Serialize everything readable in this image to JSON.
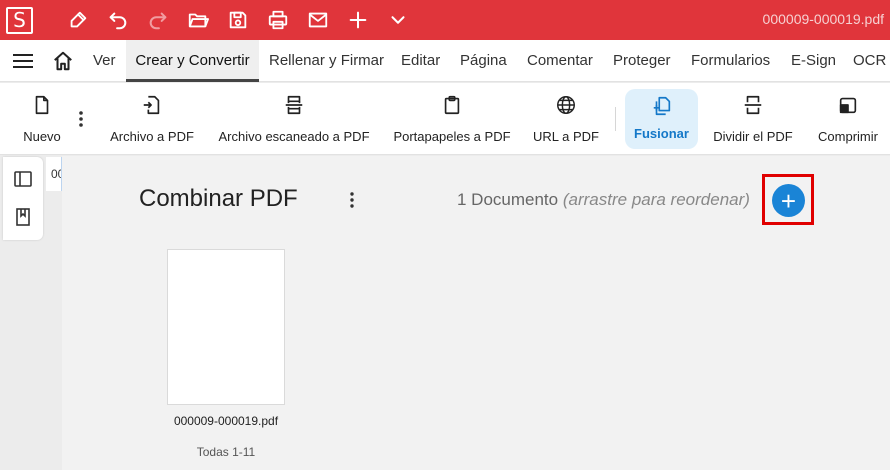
{
  "app": {
    "logo_letter": "S",
    "filename": "000009-000019.pdf",
    "brand_color": "#e0353b",
    "accent_color": "#1a84d6"
  },
  "titlebar_icons": [
    "pen-icon",
    "undo-icon",
    "redo-icon",
    "open-folder-icon",
    "save-icon",
    "print-icon",
    "mail-icon",
    "plus-icon",
    "chevron-down-icon"
  ],
  "menu": {
    "tabs": [
      "Ver",
      "Crear y Convertir",
      "Rellenar y Firmar",
      "Editar",
      "Página",
      "Comentar",
      "Proteger",
      "Formularios",
      "E-Sign",
      "OCR"
    ],
    "active_tab": "Crear y Convertir"
  },
  "toolbar": {
    "items": [
      "Nuevo",
      "Archivo a PDF",
      "Archivo escaneado a PDF",
      "Portapapeles a PDF",
      "URL a PDF",
      "Fusionar",
      "Dividir el PDF",
      "Comprimir"
    ],
    "active_item": "Fusionar"
  },
  "sidebar": {
    "page_number_partial": "00"
  },
  "main": {
    "title": "Combinar PDF",
    "doc_count": "1 Documento",
    "doc_hint": "(arrastre para reordenar)",
    "add_button": "+"
  },
  "documents": [
    {
      "name": "000009-000019.pdf",
      "pages": "Todas 1-11"
    }
  ]
}
